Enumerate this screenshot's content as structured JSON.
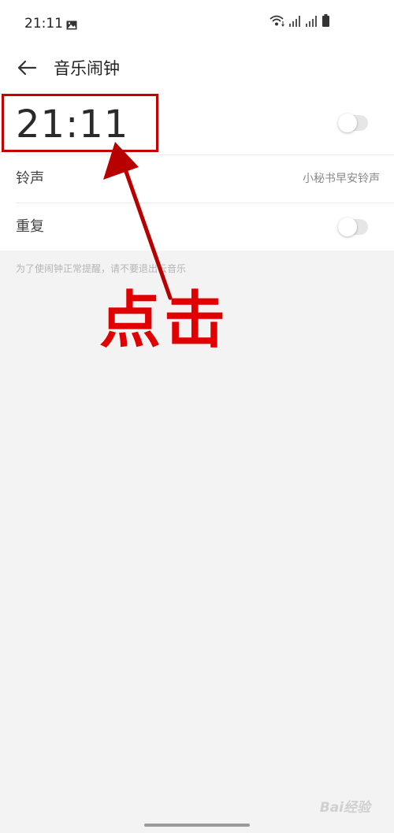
{
  "status_bar": {
    "time": "21:11",
    "icons": [
      "gallery-icon",
      "wifi-icon",
      "signal-icon",
      "signal-icon",
      "battery-icon"
    ]
  },
  "header": {
    "title": "音乐闹钟",
    "back_icon": "arrow-left-icon"
  },
  "alarm": {
    "time": "21:11",
    "enabled": false
  },
  "settings": {
    "ringtone_label": "铃声",
    "ringtone_value": "小秘书早安铃声",
    "repeat_label": "重复",
    "repeat_enabled": false
  },
  "hint": "为了使闹钟正常提醒，请不要退出云音乐",
  "annotation": {
    "label": "点击",
    "color": "#e00000",
    "box_color": "#c40000"
  },
  "watermark": "Bai经验",
  "colors": {
    "background": "#f3f3f3",
    "card": "#ffffff",
    "toggle_off": "#e6e6e6"
  }
}
